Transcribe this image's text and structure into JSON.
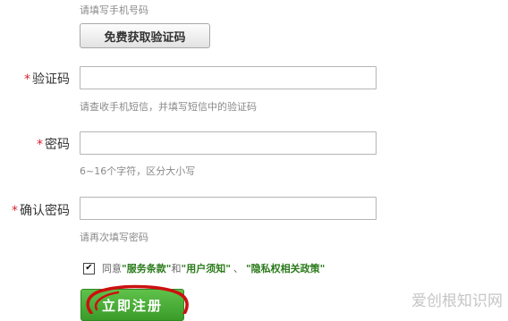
{
  "phone": {
    "hint": "请填写手机号码"
  },
  "sms_button": {
    "label": "免费获取验证码"
  },
  "code": {
    "star": "*",
    "label": "验证码",
    "value": "",
    "hint": "请查收手机短信，并填写短信中的验证码"
  },
  "password": {
    "star": "*",
    "label": "密码",
    "value": "",
    "hint": "6~16个字符，区分大小写"
  },
  "confirm": {
    "star": "*",
    "label": "确认密码",
    "value": "",
    "hint": "请再次填写密码"
  },
  "agreement": {
    "checked_mark": "✔",
    "prefix": "同意",
    "terms": "\"服务条款\"",
    "and": "和",
    "notice": "\"用户须知\"",
    "sep": "、",
    "privacy": "\"隐私权相关政策\""
  },
  "register_button": {
    "label": "立即注册"
  },
  "watermark": "爱创根知识网",
  "colors": {
    "required_star": "#d9232d",
    "link": "#2a7a1a",
    "register_bg": "#4cae38",
    "annotation": "#cc1010"
  }
}
